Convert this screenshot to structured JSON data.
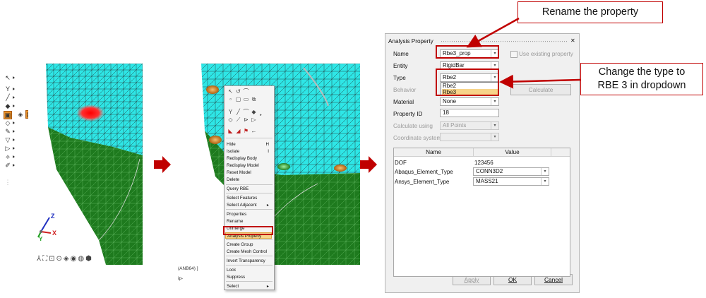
{
  "panel1": {
    "axes": {
      "z": "Z",
      "x": "X",
      "y": "Y"
    }
  },
  "panel2": {
    "status_line1": "(ANB64) ]",
    "status_line2": "ip-",
    "context_menu": {
      "items": [
        {
          "label": "Hide",
          "shortcut": "H"
        },
        {
          "label": "Isolate",
          "shortcut": "I"
        },
        {
          "label": "Redisplay Body",
          "shortcut": ""
        },
        {
          "label": "Redisplay Model",
          "shortcut": ""
        },
        {
          "label": "Reset Model",
          "shortcut": ""
        },
        {
          "label": "Delete",
          "shortcut": ""
        },
        {
          "label": "Query RBE",
          "shortcut": ""
        },
        {
          "label": "Select Features",
          "shortcut": ""
        },
        {
          "label": "Select Adjacent",
          "shortcut": "▸"
        },
        {
          "label": "Properties",
          "shortcut": ""
        },
        {
          "label": "Rename",
          "shortcut": ""
        },
        {
          "label": "Unmerge",
          "shortcut": ""
        },
        {
          "label": "Analysis Property",
          "shortcut": ""
        },
        {
          "label": "Create Group",
          "shortcut": ""
        },
        {
          "label": "Create Mesh Control",
          "shortcut": ""
        },
        {
          "label": "Invert Transparency",
          "shortcut": ""
        },
        {
          "label": "Lock",
          "shortcut": ""
        },
        {
          "label": "Suppress",
          "shortcut": ""
        },
        {
          "label": "Select",
          "shortcut": "▸"
        }
      ]
    }
  },
  "dialog": {
    "title": "Analysis Property",
    "close_glyph": "✕",
    "name_label": "Name",
    "name_value": "Rbe3_prop",
    "use_existing_label": "Use existing property",
    "entity_label": "Entity",
    "entity_value": "RigidBar",
    "type_label": "Type",
    "type_value": "Rbe2",
    "type_options": [
      "Rbe2",
      "Rbe3"
    ],
    "behavior_label": "Behavior",
    "calculate_label": "Calculate",
    "material_label": "Material",
    "material_value": "None",
    "property_id_label": "Property ID",
    "property_id_value": "18",
    "calculate_using_label": "Calculate using",
    "calculate_using_value": "All Points",
    "coord_system_label": "Coordinate system",
    "coord_system_value": "",
    "table": {
      "headers": [
        "Name",
        "Value"
      ],
      "rows": [
        {
          "name": "DOF",
          "value": "123456",
          "dropdown": false
        },
        {
          "name": "Abaqus_Element_Type",
          "value": "CONN3D2",
          "dropdown": true
        },
        {
          "name": "Ansys_Element_Type",
          "value": "MASS21",
          "dropdown": true
        }
      ]
    },
    "apply_label": "Apply",
    "ok_label": "OK",
    "cancel_label": "Cancel"
  },
  "annotations": {
    "rename_callout": "Rename the property",
    "type_callout_line1": "Change the type to",
    "type_callout_line2": "RBE 3 in dropdown"
  },
  "colors": {
    "mesh_cyan": "#2ee6e6",
    "mesh_green": "#1e7a1e",
    "annotation_red": "#c00000",
    "highlight": "#f7d48a"
  }
}
